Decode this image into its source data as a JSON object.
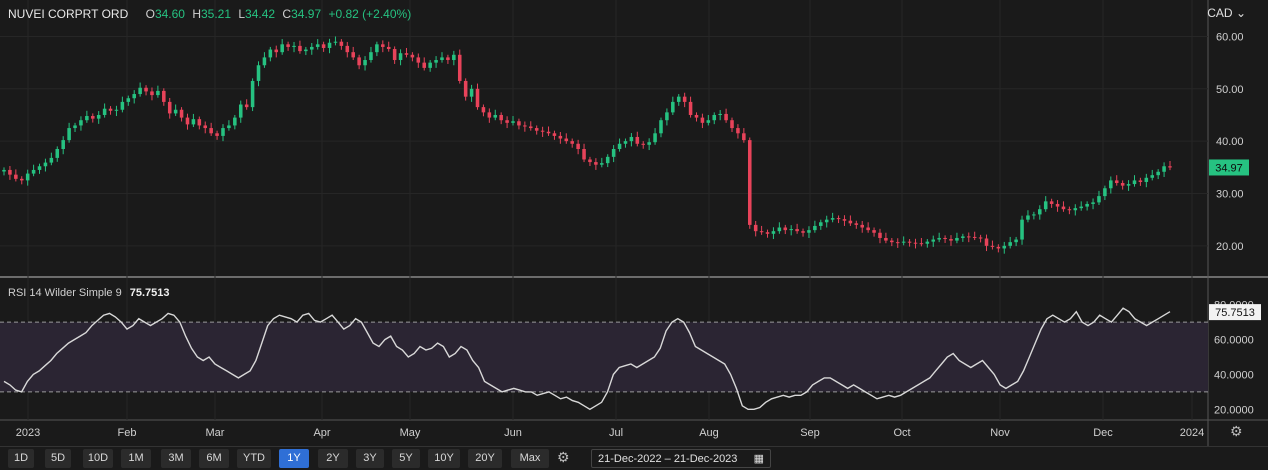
{
  "header": {
    "symbol": "NUVEI CORPRT ORD",
    "o_label": "O",
    "o_value": "34.60",
    "h_label": "H",
    "h_value": "35.21",
    "l_label": "L",
    "l_value": "34.42",
    "c_label": "C",
    "c_value": "34.97",
    "change": "+0.82 (+2.40%)"
  },
  "currency": "CAD",
  "last_price_label": "34.97",
  "rsi": {
    "label": "RSI 14 Wilder Simple 9",
    "value": "75.7513",
    "badge": "75.7513",
    "top_tick": "80.0000"
  },
  "colors": {
    "up": "#26c281",
    "down": "#e8435a",
    "bg": "#1a1a1a",
    "rsi_line": "#d8d8d8",
    "rsi_band": "#2b2533",
    "active": "#2f6fd6"
  },
  "toolbar": {
    "ranges": [
      "1D",
      "5D",
      "10D",
      "1M",
      "3M",
      "6M",
      "YTD",
      "1Y",
      "2Y",
      "3Y",
      "5Y",
      "10Y",
      "20Y",
      "Max"
    ],
    "active": "1Y",
    "date_range": "21-Dec-2022  –  21-Dec-2023",
    "settings_icon": "gear-icon",
    "calendar_icon": "calendar-icon"
  },
  "chart_data": [
    {
      "type": "candlestick",
      "title": "NUVEI CORPRT ORD",
      "x_ticks": [
        "2023",
        "Feb",
        "Mar",
        "Apr",
        "May",
        "Jun",
        "Jul",
        "Aug",
        "Sep",
        "Oct",
        "Nov",
        "Dec",
        "2024"
      ],
      "y_ticks": [
        "60.00",
        "50.00",
        "40.00",
        "30.00",
        "20.00"
      ],
      "ylim": [
        15,
        62
      ],
      "x_range": [
        "2022-12-21",
        "2023-12-21"
      ],
      "close": [
        34.5,
        33.6,
        32.8,
        32.5,
        33.8,
        34.5,
        35.2,
        35.9,
        36.8,
        38.5,
        40.2,
        42.5,
        43.0,
        44.0,
        44.8,
        44.3,
        45.0,
        46.2,
        45.8,
        46.0,
        47.5,
        48.2,
        49.0,
        50.2,
        49.5,
        48.8,
        49.6,
        47.5,
        45.3,
        46.0,
        44.5,
        43.2,
        44.2,
        43.0,
        42.5,
        41.5,
        41.0,
        42.5,
        43.0,
        44.5,
        47.0,
        46.5,
        51.5,
        54.5,
        56.0,
        57.5,
        57.0,
        58.5,
        58.0,
        58.2,
        57.2,
        57.5,
        58.0,
        58.5,
        57.8,
        58.8,
        59.0,
        58.2,
        57.0,
        56.0,
        54.5,
        55.5,
        57.0,
        58.5,
        58.0,
        57.6,
        55.5,
        56.8,
        56.5,
        56.0,
        55.0,
        54.0,
        55.0,
        55.5,
        56.0,
        55.5,
        56.5,
        51.5,
        48.5,
        50.0,
        46.5,
        45.5,
        44.5,
        45.0,
        44.0,
        43.5,
        43.8,
        43.0,
        42.8,
        42.5,
        42.0,
        41.8,
        41.5,
        41.0,
        40.5,
        40.0,
        39.5,
        38.5,
        36.5,
        36.0,
        35.5,
        35.8,
        37.0,
        38.5,
        39.5,
        40.0,
        40.8,
        39.5,
        39.3,
        39.8,
        41.5,
        44.0,
        45.5,
        47.5,
        48.5,
        47.5,
        45.0,
        44.5,
        43.5,
        44.0,
        45.0,
        45.2,
        44.0,
        42.5,
        41.5,
        40.2,
        24.0,
        22.8,
        22.6,
        22.3,
        22.8,
        23.5,
        23.0,
        23.2,
        22.8,
        22.5,
        23.0,
        23.8,
        24.5,
        25.0,
        25.3,
        25.1,
        24.8,
        24.3,
        24.0,
        23.5,
        23.0,
        22.5,
        21.5,
        21.0,
        20.7,
        20.6,
        20.8,
        20.6,
        20.5,
        20.4,
        20.8,
        21.2,
        21.5,
        21.3,
        21.0,
        21.5,
        21.8,
        21.7,
        21.6,
        21.4,
        20.0,
        19.8,
        19.5,
        20.0,
        20.7,
        21.2,
        25.0,
        25.8,
        26.0,
        27.0,
        28.5,
        28.0,
        27.5,
        27.0,
        26.8,
        27.2,
        27.5,
        28.0,
        28.3,
        29.5,
        31.0,
        32.5,
        32.0,
        31.5,
        31.8,
        32.5,
        32.2,
        33.0,
        33.5,
        34.15,
        35.2,
        34.97
      ]
    },
    {
      "type": "line",
      "title": "RSI 14 Wilder Simple 9",
      "y_ticks": [
        "80.0000",
        "60.0000",
        "40.0000",
        "20.0000"
      ],
      "ylim": [
        15,
        85
      ],
      "bands": [
        30,
        70
      ],
      "values": [
        36,
        34,
        31,
        30,
        36,
        40,
        42,
        45,
        48,
        52,
        55,
        58,
        60,
        62,
        64,
        68,
        71,
        74,
        75,
        73,
        70,
        66,
        68,
        72,
        70,
        68,
        70,
        72,
        75,
        74,
        70,
        62,
        55,
        50,
        48,
        50,
        46,
        44,
        42,
        40,
        38,
        40,
        42,
        48,
        58,
        68,
        72,
        74,
        73,
        72,
        70,
        74,
        75,
        71,
        70,
        72,
        74,
        70,
        66,
        68,
        72,
        70,
        64,
        58,
        56,
        60,
        62,
        56,
        54,
        50,
        52,
        56,
        54,
        55,
        58,
        56,
        50,
        52,
        56,
        54,
        48,
        44,
        36,
        34,
        32,
        30,
        31,
        32,
        31,
        30,
        30,
        28,
        29,
        30,
        28,
        26,
        27,
        25,
        24,
        22,
        20,
        22,
        24,
        30,
        40,
        44,
        45,
        46,
        44,
        46,
        48,
        50,
        55,
        65,
        70,
        72,
        70,
        64,
        56,
        54,
        52,
        50,
        48,
        46,
        40,
        32,
        22,
        20,
        20,
        21,
        24,
        26,
        27,
        28,
        27,
        28,
        28,
        30,
        34,
        36,
        38,
        38,
        36,
        34,
        32,
        34,
        32,
        30,
        28,
        26,
        27,
        28,
        27,
        28,
        30,
        32,
        34,
        36,
        38,
        42,
        46,
        50,
        52,
        48,
        46,
        44,
        46,
        48,
        44,
        40,
        34,
        32,
        34,
        36,
        42,
        50,
        58,
        66,
        72,
        74,
        72,
        70,
        72,
        76,
        70,
        68,
        70,
        74,
        72,
        70,
        74,
        78,
        76,
        72,
        70,
        68,
        70,
        72,
        74,
        76
      ]
    }
  ]
}
